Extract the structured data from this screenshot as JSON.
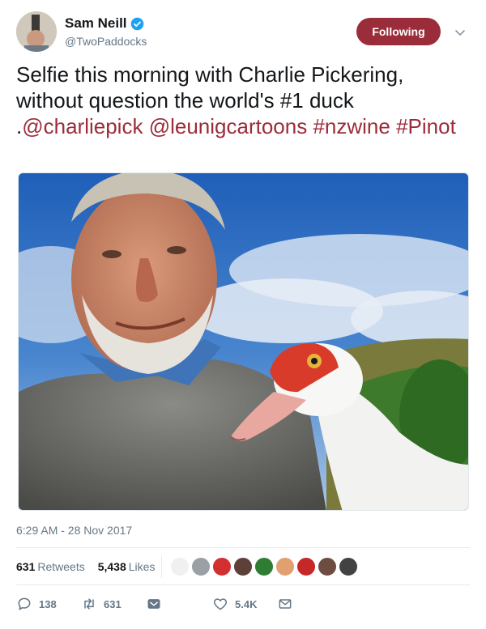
{
  "user": {
    "display_name": "Sam Neill",
    "handle": "@TwoPaddocks",
    "follow_label": "Following"
  },
  "tweet": {
    "text_plain_1": "Selfie this morning with Charlie Pickering, without question the world's #1 duck .",
    "mention_1": "@charliepick",
    "mention_2": "@leunigcartoons",
    "hashtag_1": "#nzwine",
    "hashtag_2": "#Pinot"
  },
  "timestamp": "6:29 AM - 28 Nov 2017",
  "stats": {
    "retweets_count": "631",
    "retweets_label": "Retweets",
    "likes_count": "5,438",
    "likes_label": "Likes"
  },
  "actions": {
    "replies": "138",
    "retweets": "631",
    "likes": "5.4K"
  },
  "colors": {
    "brand": "#9b2c3a",
    "muted": "#657786",
    "verified": "#1da1f2"
  }
}
